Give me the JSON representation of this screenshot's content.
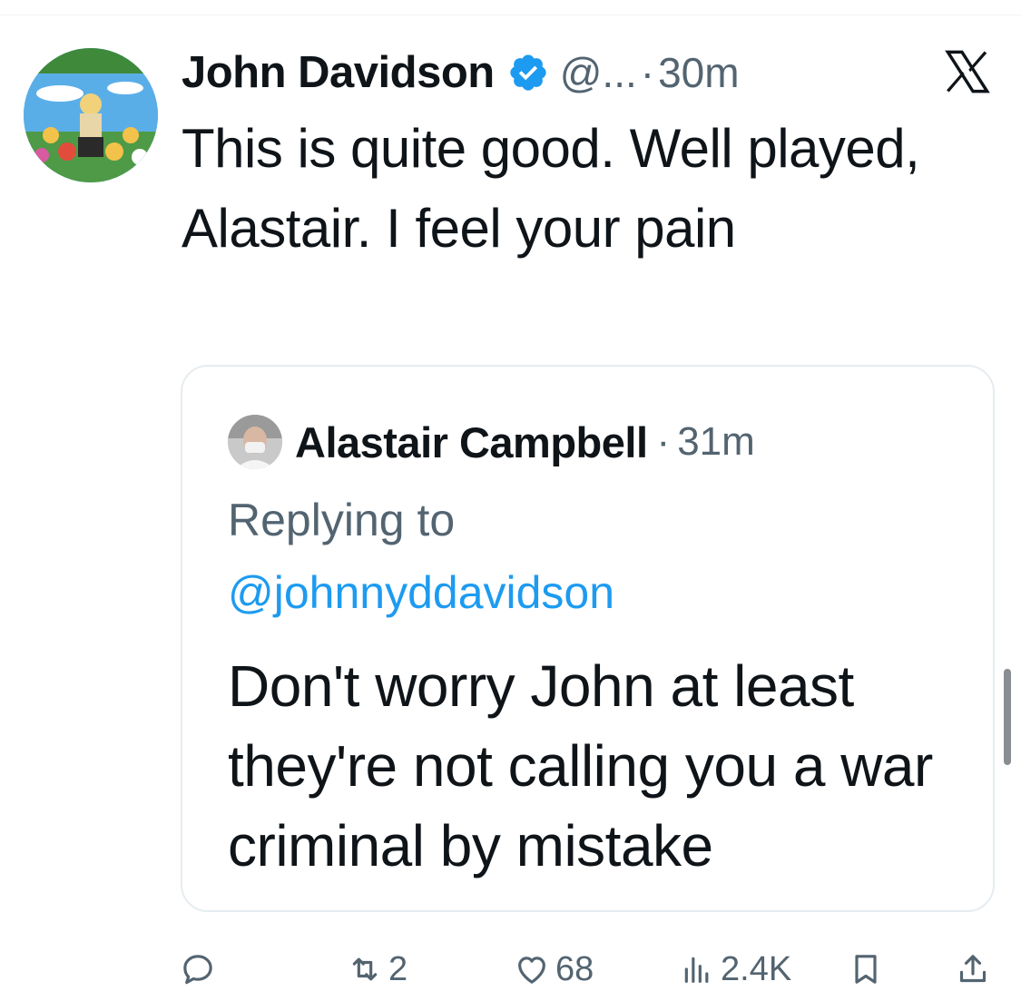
{
  "tweet": {
    "author": {
      "display_name": "John Davidson",
      "verified": true,
      "handle": "@...",
      "avatar_icon": "cartoon-avatar"
    },
    "separator": "·",
    "time": "30m",
    "text": "This is quite good. Well played, Alastair. I feel your pain"
  },
  "quoted_tweet": {
    "author": {
      "display_name": "Alastair Campbell",
      "avatar_icon": "profile-photo-avatar"
    },
    "separator": "·",
    "time": "31m",
    "replying_label": "Replying to",
    "replying_to": "@johnnyddavidson",
    "text": "Don't worry John at least they're not calling you a war criminal by mistake"
  },
  "actions": {
    "reply": {
      "icon": "reply-icon",
      "count": ""
    },
    "retweet": {
      "icon": "retweet-icon",
      "count": "2"
    },
    "like": {
      "icon": "heart-icon",
      "count": "68"
    },
    "views": {
      "icon": "analytics-icon",
      "count": "2.4K"
    },
    "bookmark": {
      "icon": "bookmark-icon"
    },
    "share": {
      "icon": "share-icon"
    }
  },
  "colors": {
    "text_primary": "#0f1419",
    "text_secondary": "#536471",
    "link": "#1d9bf0",
    "verified_badge": "#1d9bf0",
    "border": "#e6ecf0"
  }
}
